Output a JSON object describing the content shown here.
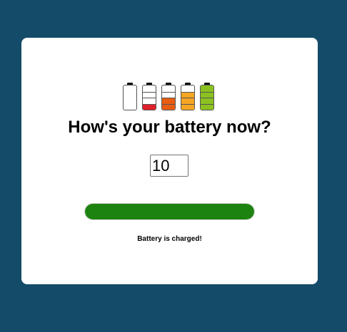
{
  "header": {
    "title": "How's your battery now?"
  },
  "batteries": [
    {
      "name": "battery-empty-icon",
      "level": 0,
      "color": "#ffffff"
    },
    {
      "name": "battery-low-icon",
      "level": 0.25,
      "color": "#e0202a"
    },
    {
      "name": "battery-medium-icon",
      "level": 0.5,
      "color": "#e85d12"
    },
    {
      "name": "battery-high-icon",
      "level": 0.75,
      "color": "#f5a623"
    },
    {
      "name": "battery-full-icon",
      "level": 1,
      "color": "#8bc220"
    }
  ],
  "input": {
    "value": "10"
  },
  "progress": {
    "level": 1,
    "color": "#1d8310"
  },
  "status": {
    "text": "Battery is charged!"
  }
}
